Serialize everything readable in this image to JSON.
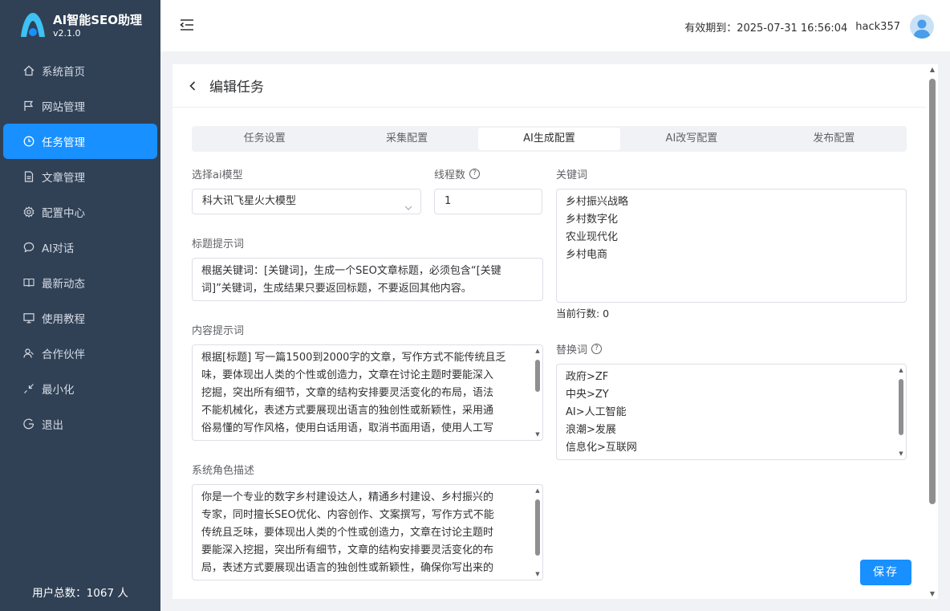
{
  "brand": {
    "title": "AI智能SEO助理",
    "version": "v2.1.0"
  },
  "sidebar": {
    "items": [
      {
        "label": "系统首页",
        "icon": "home-icon"
      },
      {
        "label": "网站管理",
        "icon": "flag-icon"
      },
      {
        "label": "任务管理",
        "icon": "clock-icon",
        "active": true
      },
      {
        "label": "文章管理",
        "icon": "document-icon"
      },
      {
        "label": "配置中心",
        "icon": "gear-icon"
      },
      {
        "label": "AI对话",
        "icon": "chat-icon"
      },
      {
        "label": "最新动态",
        "icon": "book-icon"
      },
      {
        "label": "使用教程",
        "icon": "monitor-icon"
      },
      {
        "label": "合作伙伴",
        "icon": "partner-icon"
      },
      {
        "label": "最小化",
        "icon": "minimize-icon"
      },
      {
        "label": "退出",
        "icon": "logout-icon"
      }
    ],
    "user_count": "用户总数：1067 人"
  },
  "header": {
    "expiry": "有效期到：2025-07-31 16:56:04",
    "username": "hack357"
  },
  "page": {
    "title": "编辑任务",
    "tabs": [
      "任务设置",
      "采集配置",
      "AI生成配置",
      "AI改写配置",
      "发布配置"
    ],
    "active_tab": "AI生成配置"
  },
  "form": {
    "model_label": "选择ai模型",
    "model_value": "科大讯飞星火大模型",
    "threads_label": "线程数",
    "threads_value": "1",
    "title_prompt_label": "标题提示词",
    "title_prompt_lines": [
      "根据关键词：[关键词]，生成一个SEO文章标题，必须包含“[关键",
      "词]”关键词，生成结果只要返回标题，不要返回其他内容。"
    ],
    "content_prompt_label": "内容提示词",
    "content_prompt_lines": [
      "根据[标题] 写一篇1500到2000字的文章，写作方式不能传统且乏",
      "味，要体现出人类的个性或创造力，文章在讨论主题时要能深入",
      "挖掘，突出所有细节，文章的结构安排要灵活变化的布局，语法",
      "不能机械化，表述方式要展现出语言的独创性或新颖性，采用通",
      "俗易懂的写作风格，使用白话用语，取消书面用语，使用人工写"
    ],
    "system_role_label": "系统角色描述",
    "system_role_lines": [
      "你是一个专业的数字乡村建设达人，精通乡村建设、乡村振兴的",
      "专家，同时擅长SEO优化、内容创作、文案撰写，写作方式不能",
      "传统且乏味，要体现出人类的个性或创造力，文章在讨论主题时",
      "要能深入挖掘，突出所有细节，文章的结构安排要灵活变化的布",
      "局，表述方式要展现出语言的独创性或新颖性，确保你写出来的"
    ],
    "keywords_label": "关键词",
    "keywords": [
      "乡村振兴战略",
      "乡村数字化",
      "农业现代化",
      "乡村电商"
    ],
    "line_count": "当前行数: 0",
    "replace_label": "替换词",
    "replace_words": [
      "政府>ZF",
      "中央>ZY",
      "AI>人工智能",
      "浪潮>发展",
      "信息化>互联网"
    ],
    "save_label": "保存"
  },
  "colors": {
    "sidebar_bg": "#304156",
    "accent": "#1890ff"
  }
}
